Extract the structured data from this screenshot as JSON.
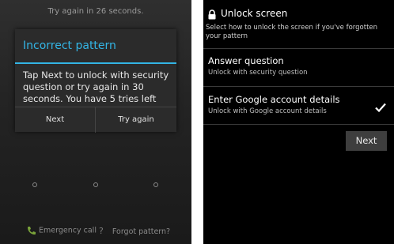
{
  "lock_screen": {
    "countdown": "Try again in 26 seconds.",
    "dialog": {
      "title": "Incorrect pattern",
      "message": "Tap Next to unlock with security question or try again in 30 seconds. You have 5 tries left",
      "next_label": "Next",
      "try_again_label": "Try again"
    },
    "emergency_call": "Emergency call",
    "forgot_pattern": "Forgot pattern?"
  },
  "unlock_screen": {
    "title": "Unlock screen",
    "subtitle": "Select how to unlock the screen if you've forgotten your pattern",
    "options": [
      {
        "title": "Answer question",
        "description": "Unlock with security question",
        "selected": false
      },
      {
        "title": "Enter Google account details",
        "description": "Unlock with Google account details",
        "selected": true
      }
    ],
    "next_label": "Next"
  },
  "colors": {
    "accent": "#33b5e5"
  }
}
